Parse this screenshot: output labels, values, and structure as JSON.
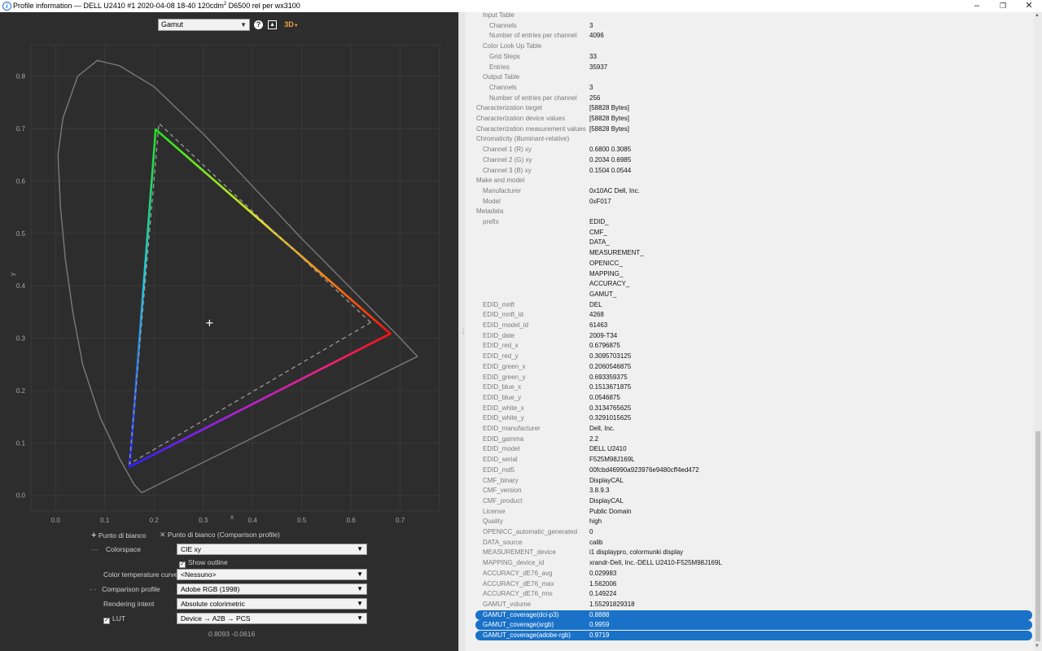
{
  "window": {
    "title": "Profile information — DELL U2410 #1 2020-04-08 18-40 120cdm",
    "title_sup": "2",
    "title_tail": " D6500 rel per wx3100",
    "minimize_icon": "minimize-icon",
    "maximize_icon": "restore-icon",
    "close_icon": "close-icon"
  },
  "toolbar": {
    "view_select": "Gamut",
    "help_icon": "question-icon",
    "image_icon": "image-icon",
    "view3d_label": "3D"
  },
  "chart_data": {
    "type": "scatter",
    "title": "",
    "xlabel": "x",
    "ylabel": "y",
    "xlim": [
      -0.05,
      0.78
    ],
    "ylim": [
      -0.03,
      0.86
    ],
    "xticks": [
      0.0,
      0.1,
      0.2,
      0.3,
      0.4,
      0.5,
      0.6,
      0.7
    ],
    "yticks": [
      0.0,
      0.1,
      0.2,
      0.3,
      0.4,
      0.5,
      0.6,
      0.7,
      0.8
    ],
    "grid": true,
    "series": [
      {
        "kind": "spectral-locus",
        "points": [
          [
            0.175,
            0.005
          ],
          [
            0.16,
            0.02
          ],
          [
            0.13,
            0.07
          ],
          [
            0.09,
            0.15
          ],
          [
            0.055,
            0.25
          ],
          [
            0.035,
            0.35
          ],
          [
            0.02,
            0.45
          ],
          [
            0.01,
            0.55
          ],
          [
            0.005,
            0.65
          ],
          [
            0.015,
            0.72
          ],
          [
            0.045,
            0.8
          ],
          [
            0.085,
            0.83
          ],
          [
            0.13,
            0.82
          ],
          [
            0.2,
            0.78
          ],
          [
            0.3,
            0.69
          ],
          [
            0.4,
            0.59
          ],
          [
            0.5,
            0.49
          ],
          [
            0.6,
            0.395
          ],
          [
            0.7,
            0.3
          ],
          [
            0.735,
            0.265
          ],
          [
            0.175,
            0.005
          ]
        ]
      },
      {
        "kind": "gamut-profile",
        "points": [
          [
            0.68,
            0.3085
          ],
          [
            0.2034,
            0.6985
          ],
          [
            0.1504,
            0.0544
          ]
        ]
      },
      {
        "kind": "gamut-comparison",
        "points": [
          [
            0.64,
            0.33
          ],
          [
            0.21,
            0.71
          ],
          [
            0.15,
            0.06
          ]
        ]
      },
      {
        "kind": "white-point",
        "points": [
          [
            0.3127,
            0.329
          ]
        ]
      }
    ]
  },
  "controls": {
    "legend_white": "Punto di bianco",
    "legend_white_cmp": "Punto di bianco (Comparison profile)",
    "colorspace_label": "Colorspace",
    "colorspace_value": "CIE xy",
    "show_outline": "Show outline",
    "ctc_label": "Color temperature curve",
    "ctc_value": "<Nessuno>",
    "comparison_label": "Comparison profile",
    "comparison_value": "Adobe RGB (1998)",
    "intent_label": "Rendering intent",
    "intent_value": "Absolute colorimetric",
    "lut_label": "LUT",
    "lut_value": "Device → A2B → PCS",
    "coords": "0.8093 -0.0616"
  },
  "table": {
    "rows": [
      {
        "k": "Input Table",
        "v": "",
        "i": 1
      },
      {
        "k": "Channels",
        "v": "3",
        "i": 2
      },
      {
        "k": "Number of entries per channel",
        "v": "4096",
        "i": 2
      },
      {
        "k": "Color Look Up Table",
        "v": "",
        "i": 1
      },
      {
        "k": "Grid Steps",
        "v": "33",
        "i": 2
      },
      {
        "k": "Entries",
        "v": "35937",
        "i": 2
      },
      {
        "k": "Output Table",
        "v": "",
        "i": 1
      },
      {
        "k": "Channels",
        "v": "3",
        "i": 2
      },
      {
        "k": "Number of entries per channel",
        "v": "256",
        "i": 2
      },
      {
        "k": "Characterization target",
        "v": "[58828 Bytes]",
        "i": 0
      },
      {
        "k": "Characterization device values",
        "v": "[58828 Bytes]",
        "i": 0
      },
      {
        "k": "Characterization measurement values",
        "v": "[58828 Bytes]",
        "i": 0
      },
      {
        "k": "Chromaticity (illuminant-relative)",
        "v": "",
        "i": 0
      },
      {
        "k": "Channel 1 (R) xy",
        "v": "0.6800 0.3085",
        "i": 1
      },
      {
        "k": "Channel 2 (G) xy",
        "v": "0.2034 0.6985",
        "i": 1
      },
      {
        "k": "Channel 3 (B) xy",
        "v": "0.1504 0.0544",
        "i": 1
      },
      {
        "k": "Make and model",
        "v": "",
        "i": 0
      },
      {
        "k": "Manufacturer",
        "v": "0x10AC Dell, Inc.",
        "i": 1
      },
      {
        "k": "Model",
        "v": "0xF017",
        "i": 1
      },
      {
        "k": "Metadata",
        "v": "",
        "i": 0
      },
      {
        "k": "prefix",
        "v": "EDID_",
        "i": 1
      },
      {
        "k": "",
        "v": "CMF_",
        "i": 1
      },
      {
        "k": "",
        "v": "DATA_",
        "i": 1
      },
      {
        "k": "",
        "v": "MEASUREMENT_",
        "i": 1
      },
      {
        "k": "",
        "v": "OPENICC_",
        "i": 1
      },
      {
        "k": "",
        "v": "MAPPING_",
        "i": 1
      },
      {
        "k": "",
        "v": "ACCURACY_",
        "i": 1
      },
      {
        "k": "",
        "v": "GAMUT_",
        "i": 1
      },
      {
        "k": "EDID_mnft",
        "v": "DEL",
        "i": 1
      },
      {
        "k": "EDID_mnft_id",
        "v": "4268",
        "i": 1
      },
      {
        "k": "EDID_model_id",
        "v": "61463",
        "i": 1
      },
      {
        "k": "EDID_date",
        "v": "2009-T34",
        "i": 1
      },
      {
        "k": "EDID_red_x",
        "v": "0.6796875",
        "i": 1
      },
      {
        "k": "EDID_red_y",
        "v": "0.3095703125",
        "i": 1
      },
      {
        "k": "EDID_green_x",
        "v": "0.2060546875",
        "i": 1
      },
      {
        "k": "EDID_green_y",
        "v": "0.693359375",
        "i": 1
      },
      {
        "k": "EDID_blue_x",
        "v": "0.1513671875",
        "i": 1
      },
      {
        "k": "EDID_blue_y",
        "v": "0.0546875",
        "i": 1
      },
      {
        "k": "EDID_white_x",
        "v": "0.3134765625",
        "i": 1
      },
      {
        "k": "EDID_white_y",
        "v": "0.3291015625",
        "i": 1
      },
      {
        "k": "EDID_manufacturer",
        "v": "Dell, Inc.",
        "i": 1
      },
      {
        "k": "EDID_gamma",
        "v": "2.2",
        "i": 1
      },
      {
        "k": "EDID_model",
        "v": "DELL U2410",
        "i": 1
      },
      {
        "k": "EDID_serial",
        "v": "F525M98J169L",
        "i": 1
      },
      {
        "k": "EDID_md5",
        "v": "00fcbd46990a923976e9480cff4ed472",
        "i": 1
      },
      {
        "k": "CMF_binary",
        "v": "DisplayCAL",
        "i": 1
      },
      {
        "k": "CMF_version",
        "v": "3.8.9.3",
        "i": 1
      },
      {
        "k": "CMF_product",
        "v": "DisplayCAL",
        "i": 1
      },
      {
        "k": "License",
        "v": "Public Domain",
        "i": 1
      },
      {
        "k": "Quality",
        "v": "high",
        "i": 1
      },
      {
        "k": "OPENICC_automatic_generated",
        "v": "0",
        "i": 1
      },
      {
        "k": "DATA_source",
        "v": "calib",
        "i": 1
      },
      {
        "k": "MEASUREMENT_device",
        "v": "i1 displaypro, colormunki display",
        "i": 1
      },
      {
        "k": "MAPPING_device_id",
        "v": "xrandr-Dell, Inc.-DELL U2410-F525M98J169L",
        "i": 1
      },
      {
        "k": "ACCURACY_dE76_avg",
        "v": "0.029983",
        "i": 1
      },
      {
        "k": "ACCURACY_dE76_max",
        "v": "1.562006",
        "i": 1
      },
      {
        "k": "ACCURACY_dE76_rms",
        "v": "0.149224",
        "i": 1
      },
      {
        "k": "GAMUT_volume",
        "v": "1.55291829318",
        "i": 1
      },
      {
        "k": "GAMUT_coverage(dci-p3)",
        "v": "0.8888",
        "i": 1,
        "hl": true
      },
      {
        "k": "GAMUT_coverage(srgb)",
        "v": "0.9959",
        "i": 1,
        "hl": true
      },
      {
        "k": "GAMUT_coverage(adobe-rgb)",
        "v": "0.9719",
        "i": 1,
        "hl": true
      }
    ]
  },
  "colors": {
    "accent": "#1a72c8",
    "plot_bg": "#2d2d2d",
    "locus": "#7a7a7a"
  }
}
